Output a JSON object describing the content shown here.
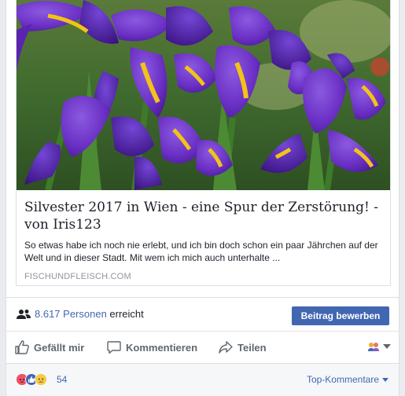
{
  "link_preview": {
    "title": "Silvester 2017 in Wien - eine Spur der Zerstörung! - von Iris123",
    "description": "So etwas habe ich noch nie erlebt, und ich bin doch schon ein paar Jährchen auf der Welt und in dieser Stadt. Mit wem ich mich auch unterhalte ...",
    "domain": "FISCHUNDFLEISCH.COM"
  },
  "reach": {
    "count_label": "8.617 Personen",
    "suffix": "erreicht",
    "boost_label": "Beitrag bewerben"
  },
  "actions": {
    "like_label": "Gefällt mir",
    "comment_label": "Kommentieren",
    "share_label": "Teilen"
  },
  "reactions": {
    "count": "54",
    "sort_label": "Top-Kommentare"
  },
  "colors": {
    "link_blue": "#4267b2",
    "action_gray": "#606770",
    "iris_purple": "#6a2fc4"
  }
}
